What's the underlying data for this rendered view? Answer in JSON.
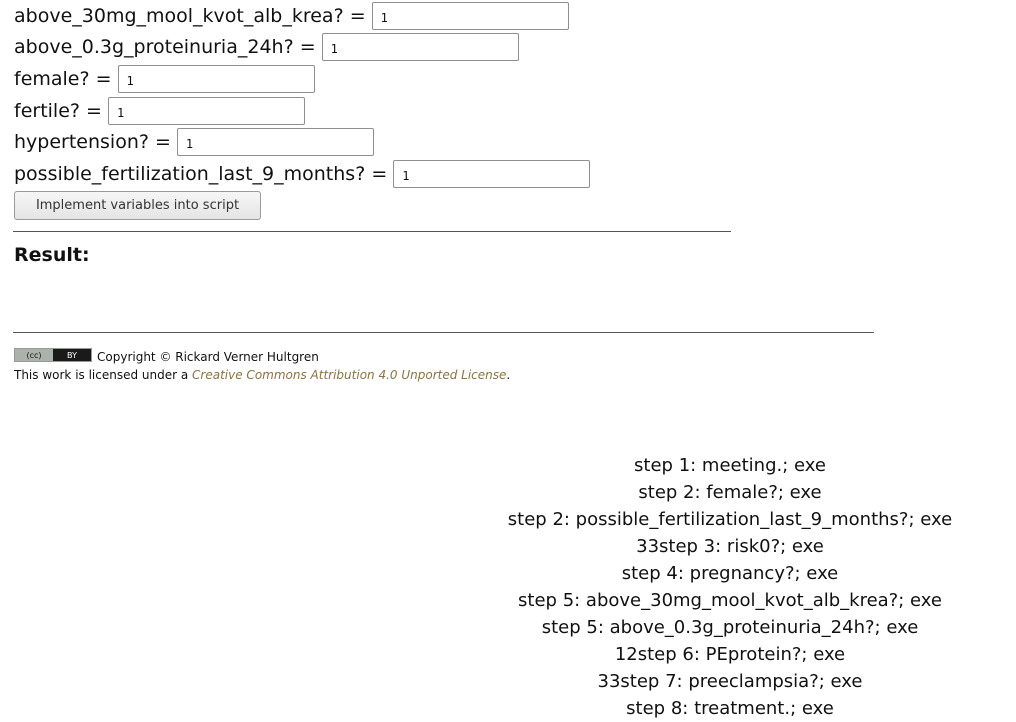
{
  "variables": [
    {
      "label": "above_30mg_mool_kvot_alb_krea? =",
      "value": "1"
    },
    {
      "label": "above_0.3g_proteinuria_24h? =",
      "value": "1"
    },
    {
      "label": "female? =",
      "value": "1"
    },
    {
      "label": "fertile? =",
      "value": "1"
    },
    {
      "label": "hypertension? =",
      "value": "1"
    },
    {
      "label": "possible_fertilization_last_9_months? =",
      "value": "1"
    }
  ],
  "implement_button_label": "Implement variables into script",
  "result_title": "Result:",
  "footer": {
    "cc_badge_left": "(cc)",
    "cc_badge_right": "BY",
    "copyright": "Copyright © Rickard Verner Hultgren",
    "license_prefix": "This work is licensed under a ",
    "license_link": "Creative Commons Attribution 4.0 Unported License",
    "license_suffix": "."
  },
  "steps": [
    "step 1: meeting.; exe",
    "step 2: female?; exe",
    "step 2: possible_fertilization_last_9_months?; exe",
    "33step 3: risk0?; exe",
    "step 4: pregnancy?; exe",
    "step 5: above_30mg_mool_kvot_alb_krea?; exe",
    "step 5: above_0.3g_proteinuria_24h?; exe",
    "12step 6: PEprotein?; exe",
    "33step 7: preeclampsia?; exe",
    "step 8: treatment.; exe"
  ],
  "colors": {
    "link": "#8a7340",
    "rule": "#555555"
  }
}
